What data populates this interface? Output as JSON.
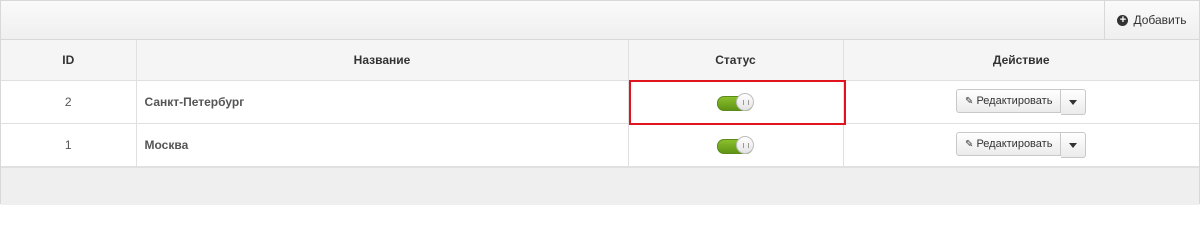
{
  "toolbar": {
    "add_label": "Добавить",
    "add_icon": "plus-circle-icon"
  },
  "table": {
    "columns": [
      "ID",
      "Название",
      "Статус",
      "Действие"
    ],
    "rows": [
      {
        "id": "2",
        "name": "Санкт-Петербург",
        "status_enabled": true,
        "edit_label": "Редактировать"
      },
      {
        "id": "1",
        "name": "Москва",
        "status_enabled": true,
        "edit_label": "Редактировать"
      }
    ]
  },
  "colors": {
    "toggle_on": "#6fa71e",
    "highlight": "#e0141e"
  }
}
